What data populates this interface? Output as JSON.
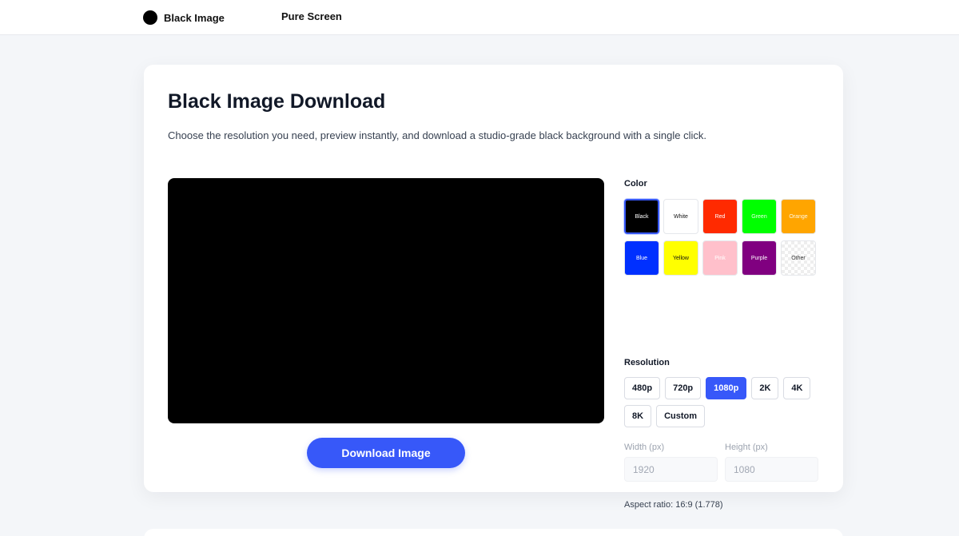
{
  "header": {
    "brand_label": "Black Image",
    "nav_link": "Pure Screen"
  },
  "main": {
    "title": "Black Image Download",
    "subtitle": "Choose the resolution you need, preview instantly, and download a studio-grade black background with a single click.",
    "preview_color": "#000000",
    "download_label": "Download Image"
  },
  "color_section": {
    "label": "Color",
    "selected": "Black",
    "swatches": [
      {
        "label": "Black",
        "bg": "#000000",
        "fg": "#ffffff"
      },
      {
        "label": "White",
        "bg": "#ffffff",
        "fg": "#111111"
      },
      {
        "label": "Red",
        "bg": "#ff2a00",
        "fg": "#ffffff"
      },
      {
        "label": "Green",
        "bg": "#00ff00",
        "fg": "#e6ffe6"
      },
      {
        "label": "Orange",
        "bg": "#ffa500",
        "fg": "#fff6e0"
      },
      {
        "label": "Blue",
        "bg": "#0030ff",
        "fg": "#ffffff"
      },
      {
        "label": "Yellow",
        "bg": "#ffff00",
        "fg": "#111111"
      },
      {
        "label": "Pink",
        "bg": "#ffc0cb",
        "fg": "#ffffff"
      },
      {
        "label": "Purple",
        "bg": "#800080",
        "fg": "#ffffff"
      },
      {
        "label": "Other",
        "bg": "checker",
        "fg": "#333333"
      }
    ]
  },
  "resolution_section": {
    "label": "Resolution",
    "selected": "1080p",
    "options": [
      "480p",
      "720p",
      "1080p",
      "2K",
      "4K",
      "8K",
      "Custom"
    ]
  },
  "dimensions": {
    "width_label": "Width (px)",
    "width_placeholder": "1920",
    "height_label": "Height (px)",
    "height_placeholder": "1080"
  },
  "aspect_ratio": "Aspect ratio: 16:9 (1.778)",
  "colors": {
    "accent": "#3758f9",
    "page_bg": "#f4f6f9"
  }
}
